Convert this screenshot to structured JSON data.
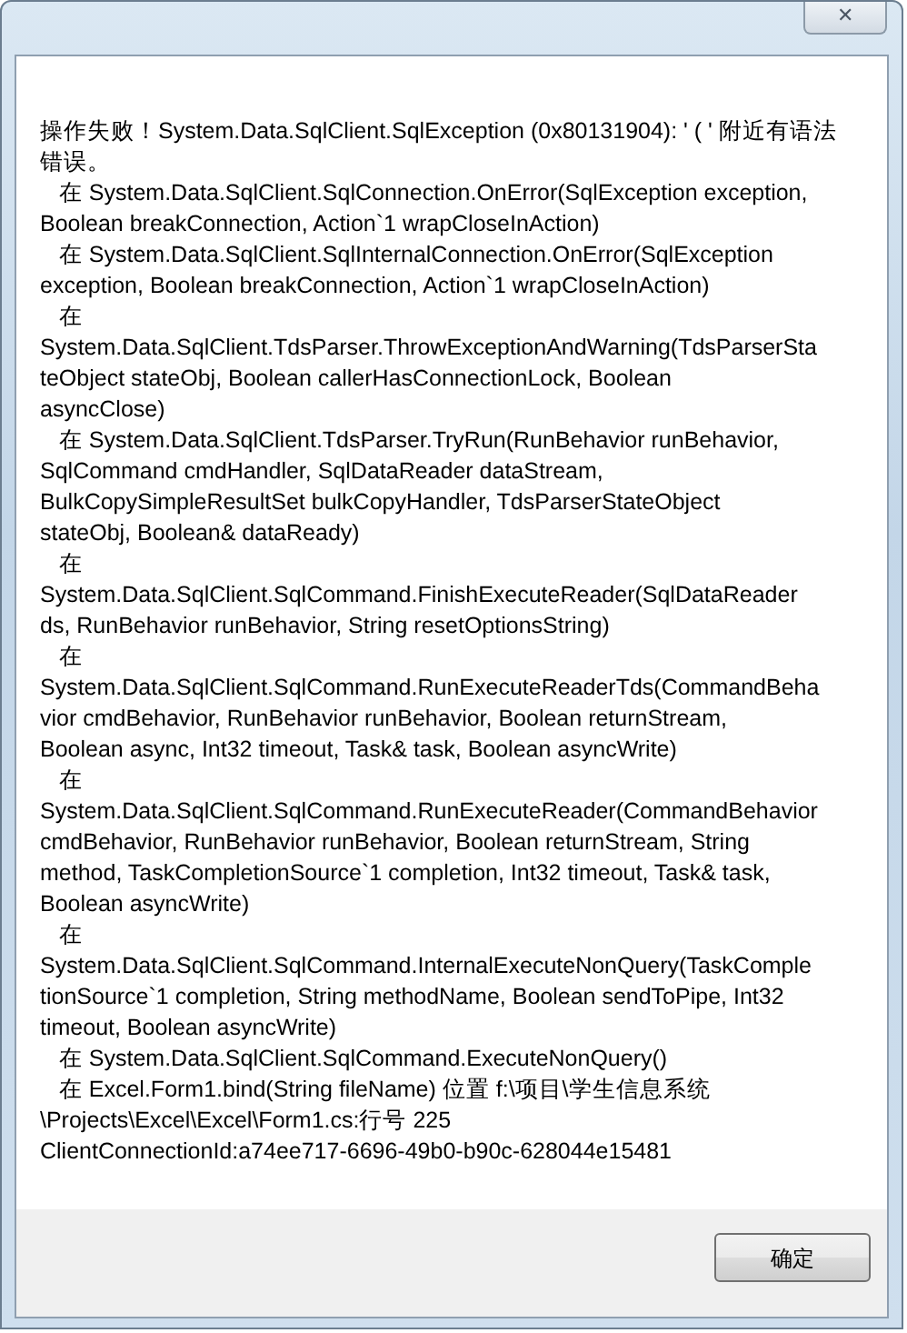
{
  "message_lines": [
    "操作失败！System.Data.SqlClient.SqlException (0x80131904): ' ( ' 附近有语法",
    "错误。",
    "   在 System.Data.SqlClient.SqlConnection.OnError(SqlException exception,",
    "Boolean breakConnection, Action`1 wrapCloseInAction)",
    "   在 System.Data.SqlClient.SqlInternalConnection.OnError(SqlException",
    "exception, Boolean breakConnection, Action`1 wrapCloseInAction)",
    "   在",
    "System.Data.SqlClient.TdsParser.ThrowExceptionAndWarning(TdsParserSta",
    "teObject stateObj, Boolean callerHasConnectionLock, Boolean",
    "asyncClose)",
    "   在 System.Data.SqlClient.TdsParser.TryRun(RunBehavior runBehavior,",
    "SqlCommand cmdHandler, SqlDataReader dataStream,",
    "BulkCopySimpleResultSet bulkCopyHandler, TdsParserStateObject",
    "stateObj, Boolean& dataReady)",
    "   在",
    "System.Data.SqlClient.SqlCommand.FinishExecuteReader(SqlDataReader",
    "ds, RunBehavior runBehavior, String resetOptionsString)",
    "   在",
    "System.Data.SqlClient.SqlCommand.RunExecuteReaderTds(CommandBeha",
    "vior cmdBehavior, RunBehavior runBehavior, Boolean returnStream,",
    "Boolean async, Int32 timeout, Task& task, Boolean asyncWrite)",
    "   在",
    "System.Data.SqlClient.SqlCommand.RunExecuteReader(CommandBehavior",
    "cmdBehavior, RunBehavior runBehavior, Boolean returnStream, String",
    "method, TaskCompletionSource`1 completion, Int32 timeout, Task& task,",
    "Boolean asyncWrite)",
    "   在",
    "System.Data.SqlClient.SqlCommand.InternalExecuteNonQuery(TaskComple",
    "tionSource`1 completion, String methodName, Boolean sendToPipe, Int32",
    "timeout, Boolean asyncWrite)",
    "   在 System.Data.SqlClient.SqlCommand.ExecuteNonQuery()",
    "   在 Excel.Form1.bind(String fileName) 位置 f:\\项目\\学生信息系统",
    "\\Projects\\Excel\\Excel\\Form1.cs:行号 225",
    "ClientConnectionId:a74ee717-6696-49b0-b90c-628044e15481"
  ],
  "close_button": {
    "label": "✕"
  },
  "ok_button": {
    "label": "确定"
  }
}
